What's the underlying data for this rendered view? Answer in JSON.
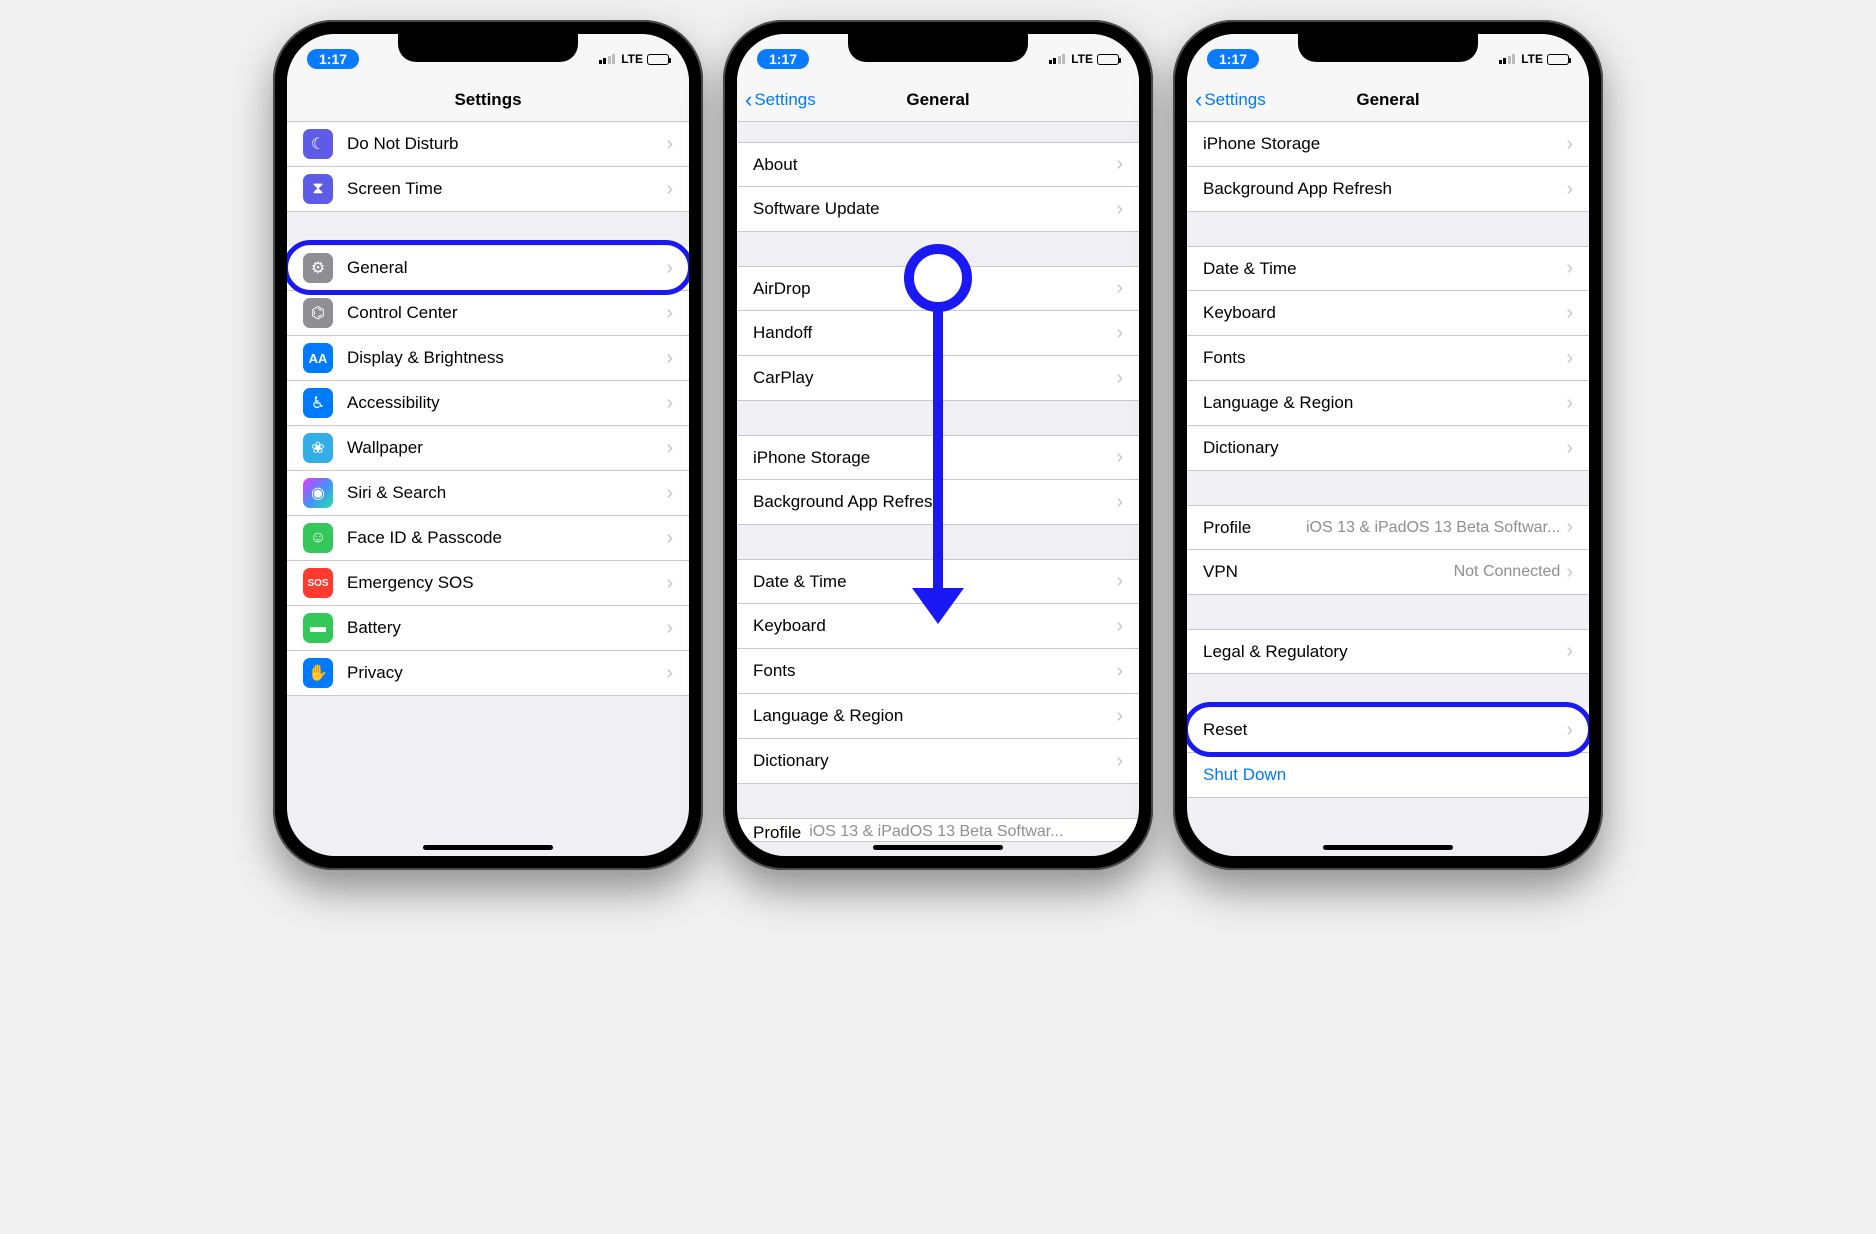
{
  "status": {
    "time": "1:17",
    "carrier": "LTE"
  },
  "phone1": {
    "title": "Settings",
    "rows": {
      "dnd": "Do Not Disturb",
      "screentime": "Screen Time",
      "general": "General",
      "control": "Control Center",
      "display": "Display & Brightness",
      "access": "Accessibility",
      "wallpaper": "Wallpaper",
      "siri": "Siri & Search",
      "faceid": "Face ID & Passcode",
      "sos": "Emergency SOS",
      "sos_badge": "SOS",
      "battery": "Battery",
      "privacy": "Privacy"
    }
  },
  "phone2": {
    "back": "Settings",
    "title": "General",
    "rows": {
      "about": "About",
      "software": "Software Update",
      "airdrop": "AirDrop",
      "handoff": "Handoff",
      "carplay": "CarPlay",
      "storage": "iPhone Storage",
      "bgrefresh": "Background App Refresh",
      "date": "Date & Time",
      "keyboard": "Keyboard",
      "fonts": "Fonts",
      "language": "Language & Region",
      "dictionary": "Dictionary",
      "profile_label": "Profile",
      "profile_value": "iOS 13 & iPadOS 13 Beta Softwar..."
    }
  },
  "phone3": {
    "back": "Settings",
    "title": "General",
    "rows": {
      "storage": "iPhone Storage",
      "bgrefresh": "Background App Refresh",
      "date": "Date & Time",
      "keyboard": "Keyboard",
      "fonts": "Fonts",
      "language": "Language & Region",
      "dictionary": "Dictionary",
      "profile_label": "Profile",
      "profile_value": "iOS 13 & iPadOS 13 Beta Softwar...",
      "vpn_label": "VPN",
      "vpn_value": "Not Connected",
      "legal": "Legal & Regulatory",
      "reset": "Reset",
      "shutdown": "Shut Down"
    }
  }
}
